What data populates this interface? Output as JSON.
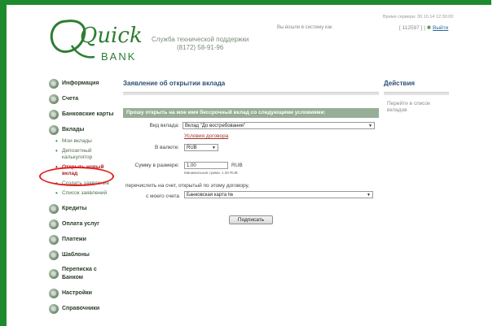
{
  "colors": {
    "frame": "#1e8a2e",
    "accent": "#2c4f73",
    "panel_head": "#97ae96",
    "highlight_circle": "#e41e1e"
  },
  "header": {
    "logo": {
      "word": "Quick",
      "sub": "BANK"
    },
    "support_title": "Служба технической поддержки",
    "support_phone": "(8172) 58-91-96",
    "logged_in": "Вы вошли в систему как",
    "server_time": "Время сервера: 30.10.14 12:30:00",
    "user_id": "[ 112597 ]",
    "separator": "|",
    "exit_label": "Выйти",
    "exit_icon": "gear-icon"
  },
  "sidebar": {
    "items": [
      {
        "label": "Информация",
        "icon": "info-icon"
      },
      {
        "label": "Счета",
        "icon": "accounts-icon"
      },
      {
        "label": "Банковские карты",
        "icon": "cards-icon"
      },
      {
        "label": "Вклады",
        "icon": "deposits-icon"
      }
    ],
    "deposits_sub": [
      {
        "label": "Мои вклады"
      },
      {
        "label": "Депозитный калькулятор"
      },
      {
        "label": "Открыть новый вклад"
      },
      {
        "label": "Создать заявление"
      },
      {
        "label": "Список заявлений"
      }
    ],
    "items_after": [
      {
        "label": "Кредиты",
        "icon": "credits-icon"
      },
      {
        "label": "Оплата услуг",
        "icon": "payment-icon"
      },
      {
        "label": "Платежи",
        "icon": "transfers-icon"
      },
      {
        "label": "Шаблоны",
        "icon": "templates-icon"
      },
      {
        "label": "Переписка с Банком",
        "icon": "messages-icon"
      },
      {
        "label": "Настройки",
        "icon": "settings-icon"
      },
      {
        "label": "Справочники",
        "icon": "directory-icon"
      }
    ]
  },
  "main": {
    "title": "Заявление об открытии вклада",
    "panel_heading": "Прошу открыть на мое имя бессрочный вклад со следующими условиями:",
    "deposit_type_label": "Вид вклада:",
    "deposit_type_value": "Вклад \"До востребования\"",
    "terms_link": "Условия договора",
    "currency_label": "В валюте:",
    "currency_value": "RUB",
    "amount_label": "Сумму в размере:",
    "amount_value": "1.00",
    "amount_currency": "RUB",
    "min_amount_note": "Минимальная сумма: 1.00 RUB",
    "transfer_text": "перечислить на счет, открытый по этому договору,",
    "from_account_label": "с моего счета",
    "from_account_value": "Банковская карта №",
    "submit_label": "Подписать"
  },
  "actions": {
    "title": "Действия",
    "link": "Перейти в список вкладов"
  }
}
